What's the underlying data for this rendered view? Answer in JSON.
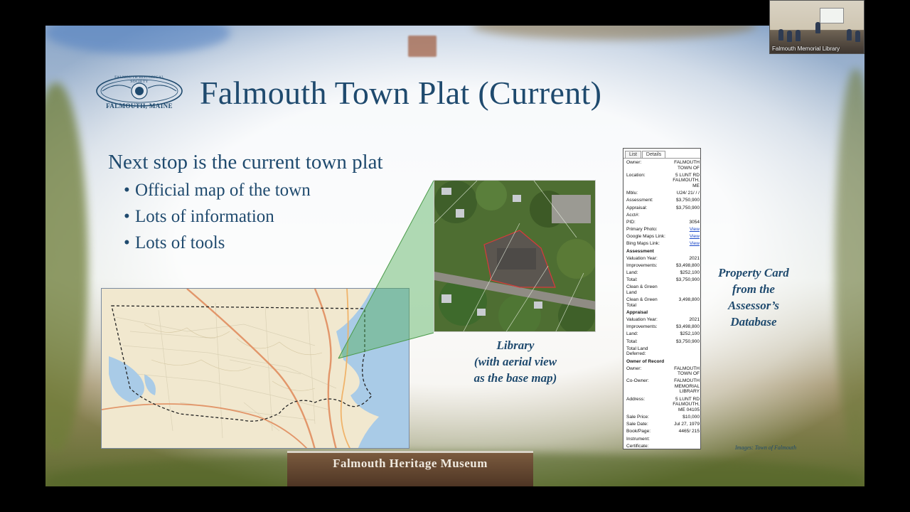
{
  "video": {
    "caption": "Falmouth Memorial Library"
  },
  "slide": {
    "title": "Falmouth Town Plat (Current)",
    "logo": {
      "society_text": "FALMOUTH HISTORICAL SOCIETY",
      "place_text": "FALMOUTH, MAINE"
    },
    "intro": "Next stop is the current town plat",
    "bullets": [
      "Official map of the town",
      "Lots of information",
      "Lots of tools"
    ],
    "aerial_caption": {
      "line1": "Library",
      "line2": "(with aerial view",
      "line3": "as the base map)"
    },
    "property_caption": {
      "line1": "Property Card",
      "line2": "from the",
      "line3": "Assessor’s",
      "line4": "Database"
    },
    "image_credit": "Images: Town of Falmouth",
    "museum_sign": "Falmouth Heritage Museum"
  },
  "property_card": {
    "tabs": [
      "List",
      "Details"
    ],
    "rows_top": [
      {
        "k": "Owner:",
        "v": "FALMOUTH TOWN OF"
      },
      {
        "k": "Location:",
        "v": "5 LUNT RD FALMOUTH, ME"
      },
      {
        "k": "Mblu:",
        "v": "U24/ 21/ / /"
      },
      {
        "k": "Assessment:",
        "v": "$3,750,900"
      },
      {
        "k": "Appraisal:",
        "v": "$3,750,900"
      },
      {
        "k": "Acct#:",
        "v": ""
      },
      {
        "k": "PID:",
        "v": "3054"
      },
      {
        "k": "Primary Photo:",
        "v": "View"
      },
      {
        "k": "Google Maps Link:",
        "v": "View"
      },
      {
        "k": "Bing Maps Link:",
        "v": "View"
      }
    ],
    "assessment_header": "Assessment",
    "assessment_rows": [
      {
        "k": "Valuation Year:",
        "v": "2021"
      },
      {
        "k": "Improvements:",
        "v": "$3,498,800"
      },
      {
        "k": "Land:",
        "v": "$252,100"
      },
      {
        "k": "Total:",
        "v": "$3,750,900"
      },
      {
        "k": "Clean & Green Land",
        "v": ""
      },
      {
        "k": "Clean & Green Total",
        "v": "3,498,800"
      }
    ],
    "appraisal_header": "Appraisal",
    "appraisal_rows": [
      {
        "k": "Valuation Year:",
        "v": "2021"
      },
      {
        "k": "Improvements:",
        "v": "$3,498,800"
      },
      {
        "k": "Land:",
        "v": "$252,100"
      },
      {
        "k": "Total:",
        "v": "$3,750,900"
      },
      {
        "k": "Total Land Deferred:",
        "v": ""
      }
    ],
    "owner_header": "Owner of Record",
    "owner_rows": [
      {
        "k": "Owner:",
        "v": "FALMOUTH TOWN OF"
      },
      {
        "k": "Co-Owner:",
        "v": "FALMOUTH MEMORIAL LIBRARY"
      },
      {
        "k": "Address:",
        "v": "5 LUNT RD FALMOUTH, ME 04105"
      },
      {
        "k": "Sale Price:",
        "v": "$10,000"
      },
      {
        "k": "Sale Date:",
        "v": "Jul 27, 1979"
      },
      {
        "k": "Book/Page:",
        "v": "4465/ 215"
      },
      {
        "k": "Instrument:",
        "v": ""
      },
      {
        "k": "Certificate:",
        "v": ""
      }
    ]
  }
}
